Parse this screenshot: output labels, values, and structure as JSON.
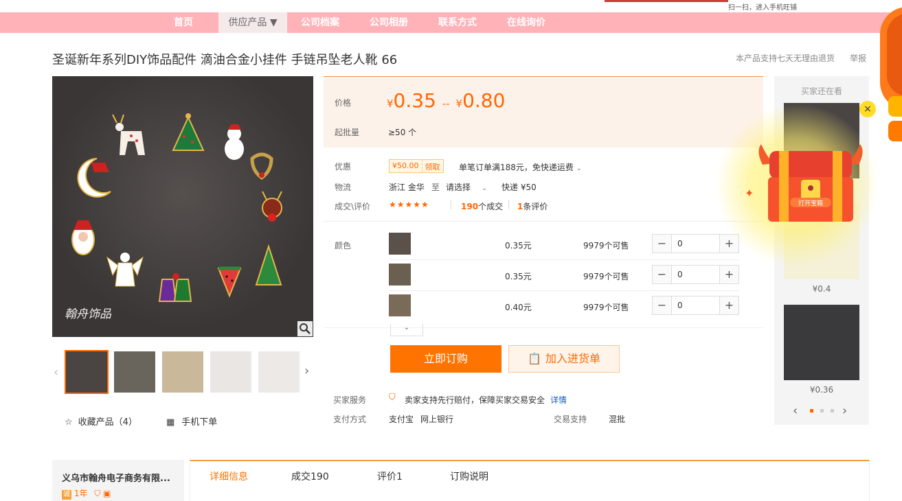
{
  "topbar": {
    "scan_text": "扫一扫，进入手机旺铺"
  },
  "nav": {
    "items": [
      "首页",
      "供应产品 ▼",
      "公司档案",
      "公司相册",
      "联系方式",
      "在线询价"
    ]
  },
  "product": {
    "title": "圣诞新年系列DIY饰品配件 滴油合金小挂件 手链吊坠老人靴 66",
    "returns": "本产品支持七天无理由退货",
    "report": "举报"
  },
  "gallery": {
    "watermark": "翰舟饰品",
    "fav_label": "收藏产品（4）",
    "mobile_label": "手机下单"
  },
  "pricing": {
    "price_label": "价格",
    "currency": "¥",
    "price_low": "0.35",
    "sep": "--",
    "price_high": "0.80",
    "moq_label": "起批量",
    "moq_value": "≥50 个"
  },
  "offers": {
    "label": "优惠",
    "coupon_value": "¥50.00",
    "coupon_claim": "领取",
    "promo_text": "单笔订单满188元，免快递运费"
  },
  "logistics": {
    "label": "物流",
    "origin": "浙江 金华",
    "to": "至",
    "dest": "请选择",
    "shipping": "快递 ¥50"
  },
  "deals": {
    "label": "成交\\评价",
    "stars": "★★★★★",
    "deal_count": "190",
    "deal_suffix": "个成交",
    "review_count": "1",
    "review_suffix": "条评价"
  },
  "skus": {
    "label": "颜色",
    "rows": [
      {
        "price": "0.35元",
        "stock": "9979个可售",
        "qty": "0"
      },
      {
        "price": "0.35元",
        "stock": "9979个可售",
        "qty": "0"
      },
      {
        "price": "0.40元",
        "stock": "9979个可售",
        "qty": "0"
      }
    ]
  },
  "actions": {
    "buy": "立即订购",
    "cart": "加入进货单"
  },
  "service": {
    "label": "买家服务",
    "text": "卖家支持先行赔付，保障买家交易安全",
    "link": "详情",
    "pay_label": "支付方式",
    "pay1": "支付宝",
    "pay2": "网上银行",
    "trade_label": "交易支持",
    "trade_value": "混批"
  },
  "sidebar": {
    "title": "买家还在看",
    "prices": [
      "¥0.4",
      "¥0.36"
    ],
    "promo_label": "打开宝箱"
  },
  "company": {
    "name": "义乌市翰舟电子商务有限...",
    "years": "1年"
  },
  "tabs": {
    "items": [
      "详细信息",
      "成交190",
      "评价1",
      "订购说明"
    ]
  },
  "colors": {
    "accent": "#ff7300",
    "nav_bg": "#ffb3b8"
  }
}
